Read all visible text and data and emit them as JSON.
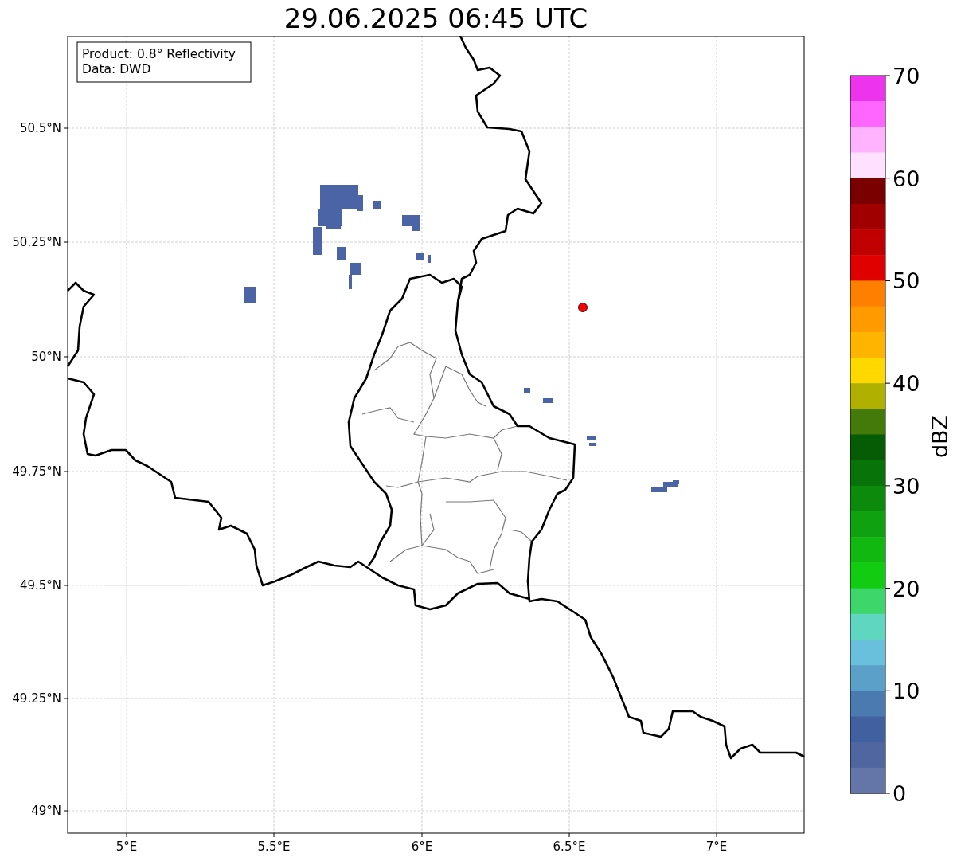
{
  "title": "29.06.2025 06:45 UTC",
  "info_box": [
    "Product: 0.8° Reflectivity",
    "Data: DWD"
  ],
  "map": {
    "lat_ticks": [
      "50.5°N",
      "50.25°N",
      "50°N",
      "49.75°N",
      "49.5°N",
      "49.25°N",
      "49°N"
    ],
    "lon_ticks": [
      "5°E",
      "5.5°E",
      "6°E",
      "6.5°E",
      "7°E"
    ]
  },
  "colorbar": {
    "label": "dBZ",
    "ticks": [
      "70",
      "60",
      "50",
      "40",
      "30",
      "20",
      "10",
      "0"
    ],
    "bins": [
      {
        "color": "#ee33ee"
      },
      {
        "color": "#ff66ff"
      },
      {
        "color": "#ffb3ff"
      },
      {
        "color": "#ffe0ff"
      },
      {
        "color": "#7a0000"
      },
      {
        "color": "#a00000"
      },
      {
        "color": "#c00000"
      },
      {
        "color": "#e00000"
      },
      {
        "color": "#ff7f00"
      },
      {
        "color": "#ff9a00"
      },
      {
        "color": "#ffb400"
      },
      {
        "color": "#ffd800"
      },
      {
        "color": "#b0b000"
      },
      {
        "color": "#447a0a"
      },
      {
        "color": "#055c05"
      },
      {
        "color": "#087308"
      },
      {
        "color": "#0c8a0c"
      },
      {
        "color": "#0fa10f"
      },
      {
        "color": "#10b810"
      },
      {
        "color": "#12cc12"
      },
      {
        "color": "#3dd66a"
      },
      {
        "color": "#5fd6c0"
      },
      {
        "color": "#68c0dc"
      },
      {
        "color": "#5aa0c8"
      },
      {
        "color": "#4a7ab0"
      },
      {
        "color": "#4060a0"
      },
      {
        "color": "#5066a0"
      },
      {
        "color": "#6475a8"
      }
    ]
  }
}
